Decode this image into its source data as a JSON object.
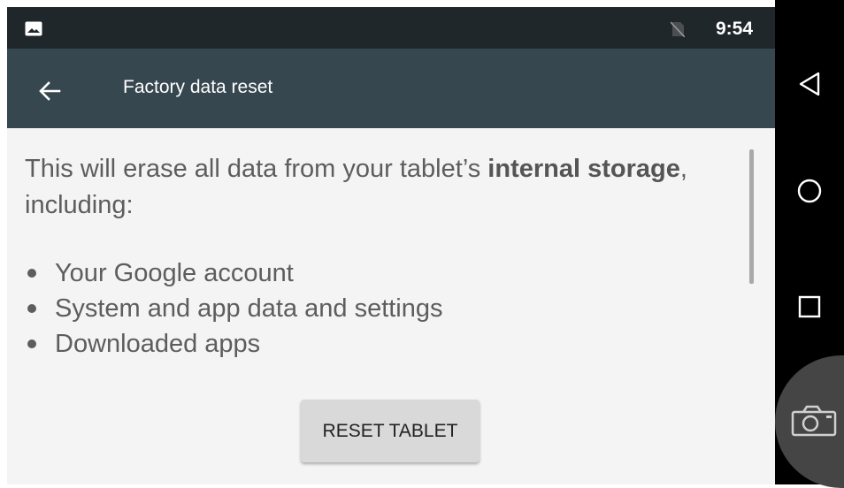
{
  "status_bar": {
    "time": "9:54",
    "left_icon": "image-notification-icon",
    "right_icon": "no-sim-icon"
  },
  "toolbar": {
    "back_icon": "arrow-back-icon",
    "title": "Factory data reset"
  },
  "content": {
    "intro_before": "This will erase all data from your tablet’s ",
    "intro_bold_1": "internal storage",
    "intro_after": ", including:",
    "items": [
      "Your Google account",
      "System and app data and settings",
      "Downloaded apps"
    ],
    "reset_button_label": "RESET TABLET"
  },
  "nav_bar": {
    "buttons": [
      "back-triangle-icon",
      "home-circle-icon",
      "recents-square-icon"
    ],
    "floating_button": "camera-icon"
  },
  "colors": {
    "status_bar_bg": "#1f272a",
    "toolbar_bg": "#37474f",
    "content_bg": "#f4f4f4",
    "button_bg": "#d9d9d9",
    "nav_bar_bg": "#000000"
  }
}
